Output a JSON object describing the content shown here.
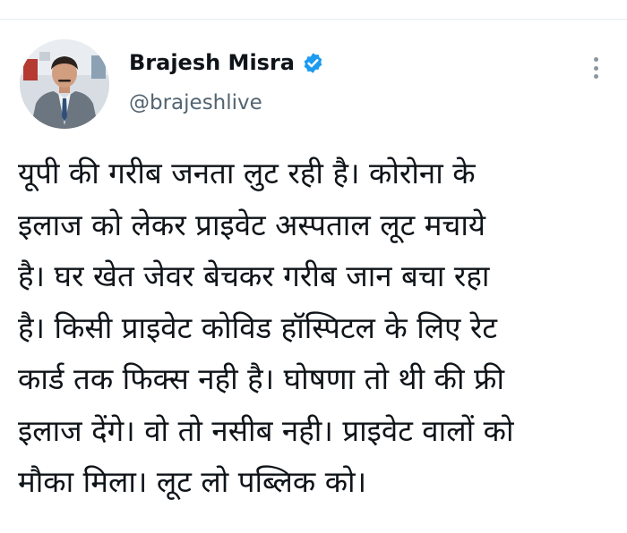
{
  "author": {
    "display_name": "Brajesh Misra",
    "username": "@brajeshlive",
    "verified": true
  },
  "icons": {
    "verified": "verified-badge-icon",
    "more": "more-options-icon"
  },
  "colors": {
    "name": "#0f1419",
    "handle": "#536471",
    "verified_blue": "#1d9bf0",
    "text": "#0f1419"
  },
  "tweet": {
    "lines": [
      "यूपी की गरीब जनता लुट रही है। कोरोना के",
      "इलाज को लेकर प्राइवेट अस्पताल लूट मचाये",
      "है। घर खेत जेवर बेचकर गरीब जान बचा रहा",
      "है। किसी प्राइवेट कोविड हॉस्पिटल के लिए रेट",
      "कार्ड तक फिक्स नही है। घोषणा तो थी की फ्री",
      "इलाज देंगे। वो तो नसीब नही। प्राइवेट वालों को",
      "मौका मिला। लूट लो पब्लिक को।"
    ]
  }
}
